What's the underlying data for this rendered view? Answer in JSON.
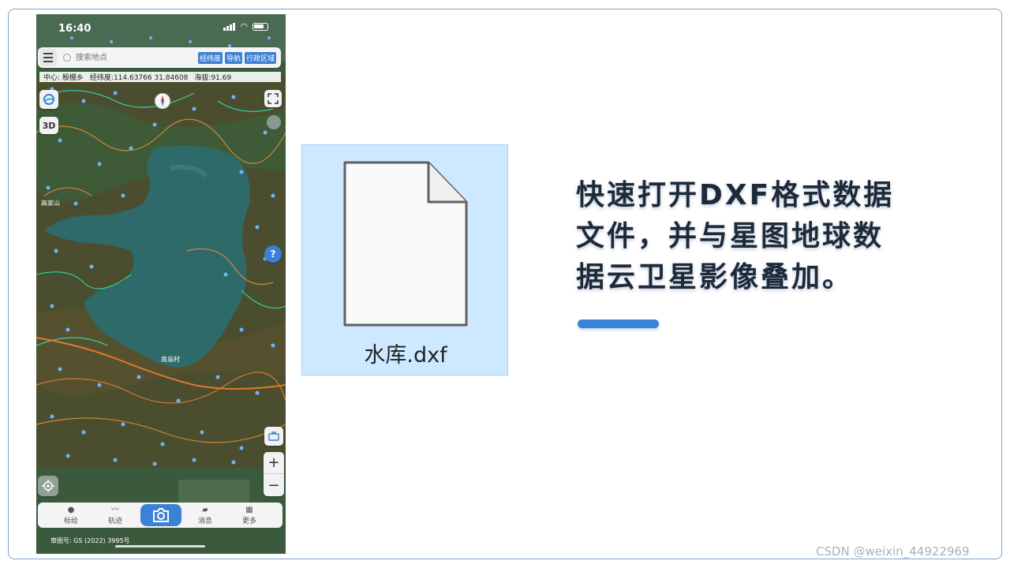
{
  "status_bar": {
    "time": "16:40"
  },
  "search": {
    "placeholder": "搜索地点",
    "buttons": [
      "经纬度",
      "导航",
      "行政区域"
    ]
  },
  "info": {
    "center": "中心: 殷棚乡",
    "coords": "经纬度:114.63766   31.84608",
    "altitude": "海拔:91.69"
  },
  "map": {
    "mode_label": "3D",
    "help_label": "?",
    "zoom_in": "+",
    "zoom_out": "−",
    "place_labels": [
      "高家山",
      "南庙村"
    ]
  },
  "tabbar": {
    "tabs": [
      "标绘",
      "轨迹",
      "消息",
      "更多"
    ]
  },
  "map_footer": "审图号: GS (2022) 3995号",
  "file": {
    "name": "水库.dxf"
  },
  "headline": {
    "lines": [
      "快速打开DXF格式数据",
      "文件，并与星图地球数",
      "据云卫星影像叠加。"
    ]
  },
  "watermark": "CSDN @weixin_44922969",
  "colors": {
    "accent": "#3b82d6",
    "tile_bg": "#cde8ff",
    "map_water": "#2f6a6a"
  }
}
